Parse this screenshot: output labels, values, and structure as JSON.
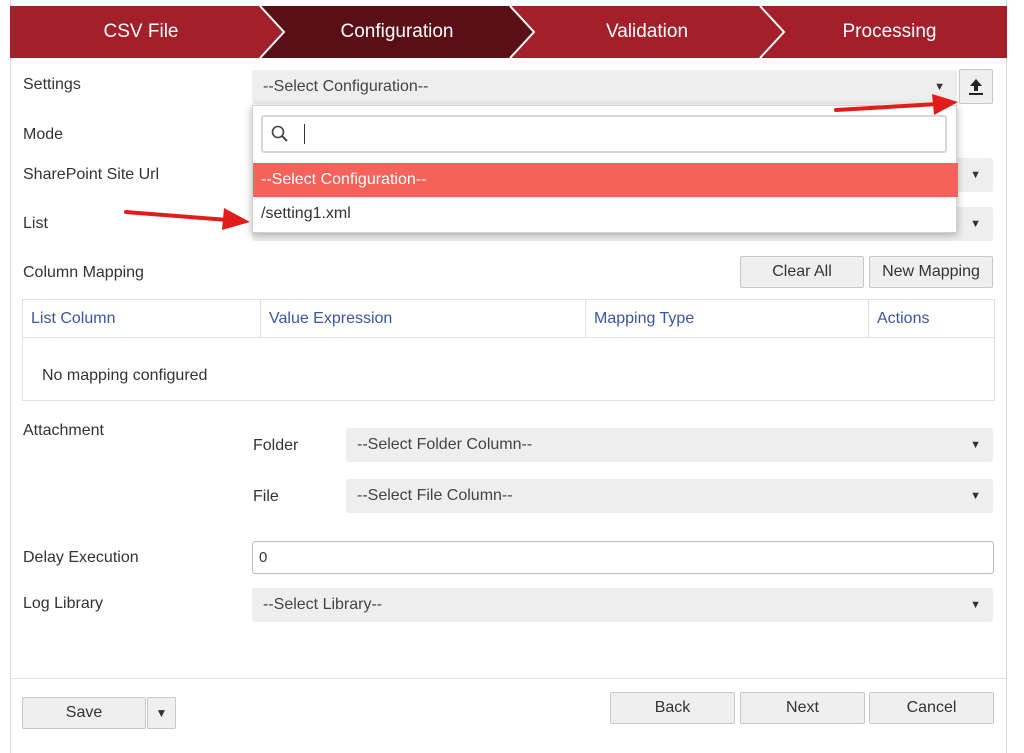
{
  "wizard": {
    "steps": [
      "CSV File",
      "Configuration",
      "Validation",
      "Processing"
    ],
    "active_index": 1,
    "colors": {
      "inactive": "#a31f2a",
      "active": "#5a0f17"
    }
  },
  "settings": {
    "label": "Settings",
    "value": "--Select Configuration--",
    "upload_icon": "upload-icon"
  },
  "mode": {
    "label": "Mode"
  },
  "site": {
    "label": "SharePoint Site Url"
  },
  "list": {
    "label": "List"
  },
  "dropdown": {
    "search_placeholder": "",
    "options": [
      "--Select Configuration--",
      "/setting1.xml"
    ],
    "highlight_color": "#f4625a"
  },
  "mapping": {
    "label": "Column Mapping",
    "clear_all": "Clear All",
    "new_mapping": "New Mapping",
    "columns": [
      "List Column",
      "Value Expression",
      "Mapping Type",
      "Actions"
    ],
    "empty_text": "No mapping configured"
  },
  "attachment": {
    "label": "Attachment",
    "folder_label": "Folder",
    "folder_value": "--Select Folder Column--",
    "file_label": "File",
    "file_value": "--Select File Column--"
  },
  "delay": {
    "label": "Delay Execution",
    "value": "0"
  },
  "log": {
    "label": "Log Library",
    "value": "--Select Library--"
  },
  "footer": {
    "save": "Save",
    "back": "Back",
    "next": "Next",
    "cancel": "Cancel"
  }
}
